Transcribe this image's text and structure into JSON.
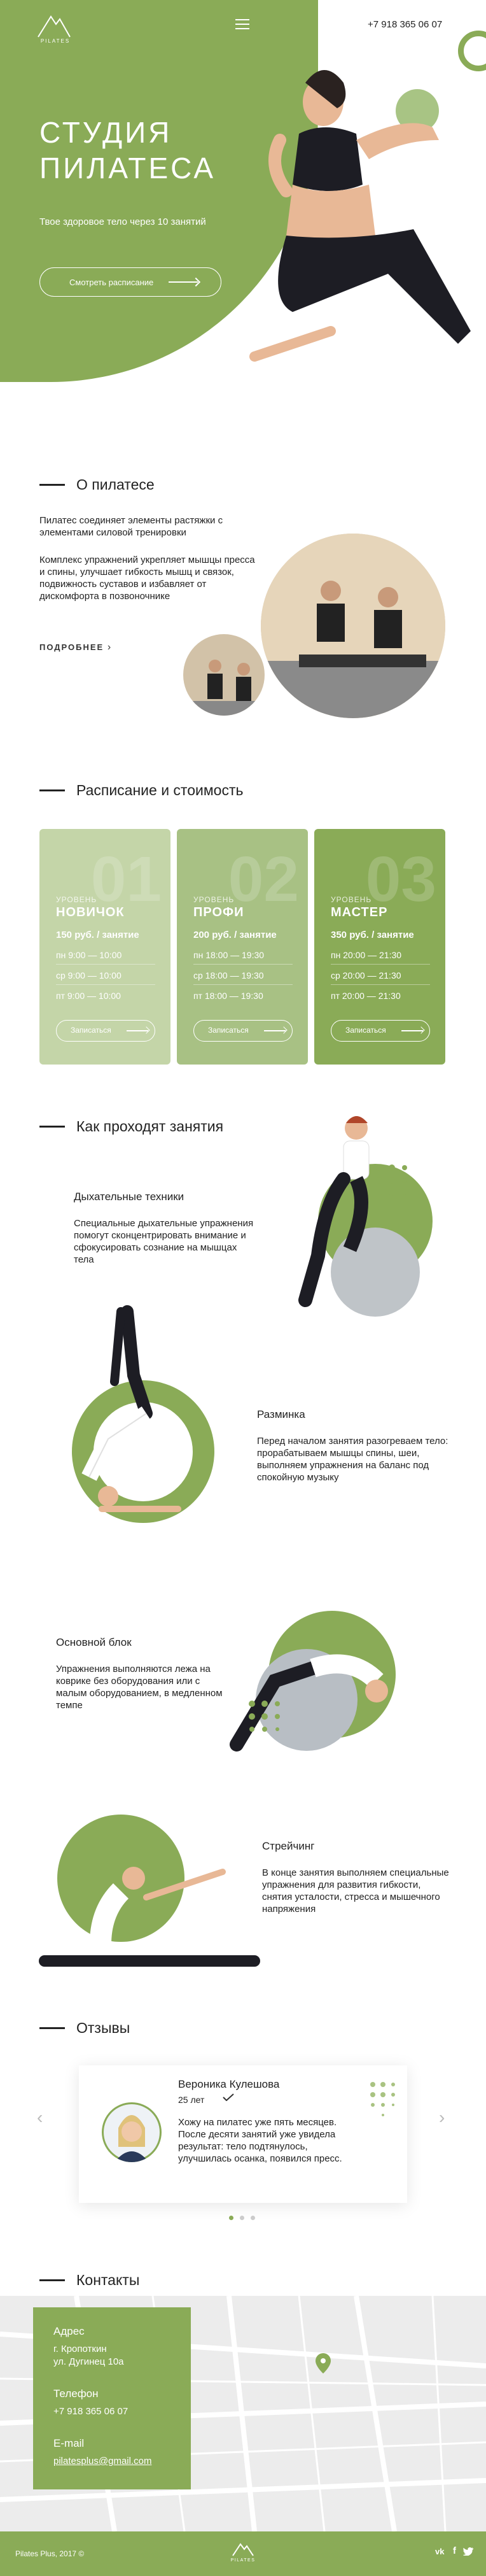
{
  "header": {
    "logo_text": "PILATES",
    "phone": "+7 918 365 06 07"
  },
  "hero": {
    "title_line1": "СТУДИЯ",
    "title_line2": "ПИЛАТЕСА",
    "subtitle": "Твое здоровое тело через 10 занятий",
    "button_label": "Смотреть расписание"
  },
  "about": {
    "heading": "О пилатесе",
    "p1": "Пилатес соединяет элементы растяжки с элементами силовой тренировки",
    "p2": "Комплекс упражнений укрепляет мышцы пресса и спины, улучшает гибкость мышц и связок, подвижность суставов и избавляет от дискомфорта в позвоночнике",
    "more_link": "ПОДРОБНЕЕ"
  },
  "schedule": {
    "heading": "Расписание и стоимость",
    "level_label": "УРОВЕНЬ",
    "button_label": "Записаться",
    "cards": [
      {
        "num": "01",
        "level": "НОВИЧОК",
        "price": "150 руб. / занятие",
        "rows": [
          "пн 9:00 — 10:00",
          "ср 9:00 — 10:00",
          "пт 9:00 — 10:00"
        ],
        "color": "#c4d5a8"
      },
      {
        "num": "02",
        "level": "ПРОФИ",
        "price": "200 руб. / занятие",
        "rows": [
          "пн 18:00 — 19:30",
          "ср 18:00 — 19:30",
          "пт 18:00 — 19:30"
        ],
        "color": "#a8c184"
      },
      {
        "num": "03",
        "level": "МАСТЕР",
        "price": "350 руб. / занятие",
        "rows": [
          "пн 20:00 — 21:30",
          "ср 20:00 — 21:30",
          "пт 20:00 — 21:30"
        ],
        "color": "#8aab57"
      }
    ]
  },
  "how": {
    "heading": "Как проходят занятия",
    "steps": [
      {
        "title": "Дыхательные техники",
        "text": "Специальные дыхательные упражнения помогут сконцентрировать внимание и сфокусировать сознание на мышцах тела"
      },
      {
        "title": "Разминка",
        "text": "Перед началом занятия разогреваем тело: прорабатываем мышцы спины, шеи, выполняем упражнения на баланс под спокойную музыку"
      },
      {
        "title": "Основной блок",
        "text": "Упражнения выполняются лежа на коврике без оборудования или с малым оборудованием, в медленном темпе"
      },
      {
        "title": "Стрейчинг",
        "text": "В конце занятия выполняем специальные упражнения для развития гибкости, снятия усталости, стресса и мышечного напряжения"
      }
    ]
  },
  "reviews": {
    "heading": "Отзывы",
    "name": "Вероника Кулешова",
    "age": "25 лет",
    "text": "Хожу на пилатес уже пять месяцев. После десяти занятий уже увидела результат: тело подтянулось, улучшилась осанка, появился пресс."
  },
  "contacts": {
    "heading": "Контакты",
    "address_label": "Адрес",
    "address_line1": "г. Кропоткин",
    "address_line2": "ул. Дугинец 10а",
    "phone_label": "Телефон",
    "phone": "+7 918 365 06 07",
    "email_label": "E-mail",
    "email": "pilatesplus@gmail.com"
  },
  "footer": {
    "copyright": "Pilates Plus, 2017 ©",
    "logo_text": "PILATES",
    "social": [
      "vk-icon",
      "facebook-icon",
      "twitter-icon"
    ]
  },
  "colors": {
    "accent": "#8aab57",
    "accent_light": "#c4d5a8"
  }
}
